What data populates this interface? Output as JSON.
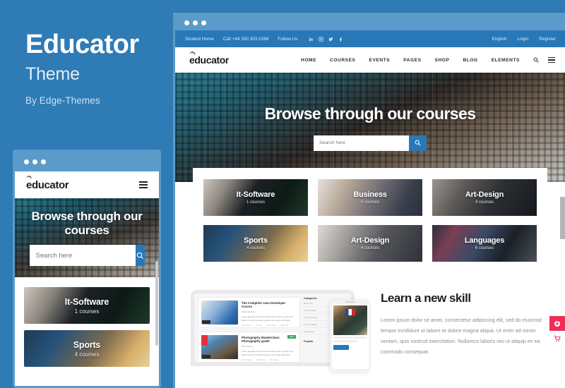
{
  "promo": {
    "title": "Educator",
    "subtitle": "Theme",
    "byline": "By Edge-Themes"
  },
  "colors": {
    "background_blue": "#2e7bb5",
    "chrome_blue": "#5b9bca",
    "accent_blue": "#2878b8",
    "accent_pink": "#ef2d56"
  },
  "site": {
    "logo": "educator",
    "topbar": {
      "student_home": "Student Home",
      "phone": "Call +44 300 303 0266",
      "follow_us": "Follow Us",
      "socials": [
        "linkedin-icon",
        "instagram-icon",
        "twitter-icon",
        "facebook-icon"
      ],
      "language": "English",
      "login": "Login",
      "register": "Register"
    },
    "nav": [
      "HOME",
      "COURSES",
      "EVENTS",
      "PAGES",
      "SHOP",
      "BLOG",
      "ELEMENTS"
    ],
    "nav_icons": [
      "search-icon",
      "hamburger-icon"
    ],
    "hero": {
      "title": "Browse through our courses",
      "search_placeholder": "Search here",
      "search_value": "",
      "search_button_icon": "search-icon"
    },
    "categories": [
      {
        "name": "It-Software",
        "count": "1 courses",
        "img": "img-itsoft"
      },
      {
        "name": "Business",
        "count": "6 courses",
        "img": "img-business"
      },
      {
        "name": "Art-Design",
        "count": "4 courses",
        "img": "img-artdes"
      },
      {
        "name": "Sports",
        "count": "4 courses",
        "img": "img-sports"
      },
      {
        "name": "Art-Design",
        "count": "4 courses",
        "img": "img-artdes2"
      },
      {
        "name": "Languages",
        "count": "6 courses",
        "img": "img-lang"
      }
    ],
    "learn": {
      "title": "Learn a new skill",
      "paragraph": "Lorem ipsum dolor sit amet, consectetur adipiscing elit, sed do eiusmod tempor incididunt ut labore et dolore magna aliqua. Ut enim ad minim veniam, quis nostrud exercitation. Nullamco laboris nisi ut aliquip ex ea commodo consequat."
    },
    "laptop_preview": {
      "courses": [
        {
          "title": "The Complete Java Developer Course",
          "author": "Mark Davidson",
          "desc": "Learn java like a Professional! Start step by step from basic to build complete games and apps with java!",
          "meta": [
            "11 lectures",
            "4.5 (4)",
            "125 seats",
            "Featured"
          ],
          "badge": ""
        },
        {
          "title": "Photography Masterclass: Photography guide",
          "author": "Nick Owens",
          "desc": "Learn java like a Professional! Start step by step from basic to build complete games and apps with java!",
          "meta": [
            "19 lectures",
            "120 hours",
            "30 seats"
          ],
          "badge": "NEW"
        }
      ],
      "sidebar_heading": "Categories",
      "sidebar_items": [
        "Business",
        "Art & Design",
        "Programming",
        "IT & Software",
        "Languages"
      ],
      "sidebar_heading2": "Popular"
    },
    "side_buttons": [
      {
        "icon": "purchase-icon",
        "style": "pink"
      },
      {
        "icon": "cart-icon",
        "style": "white"
      }
    ]
  },
  "mobile": {
    "logo": "educator",
    "menu_icon": "hamburger-icon",
    "hero_title": "Browse through our courses",
    "search_placeholder": "Search here",
    "search_button_icon": "search-icon",
    "categories": [
      {
        "name": "It-Software",
        "count": "1 courses",
        "img": "img-itsoft"
      },
      {
        "name": "Sports",
        "count": "4 courses",
        "img": "img-sports"
      }
    ]
  }
}
